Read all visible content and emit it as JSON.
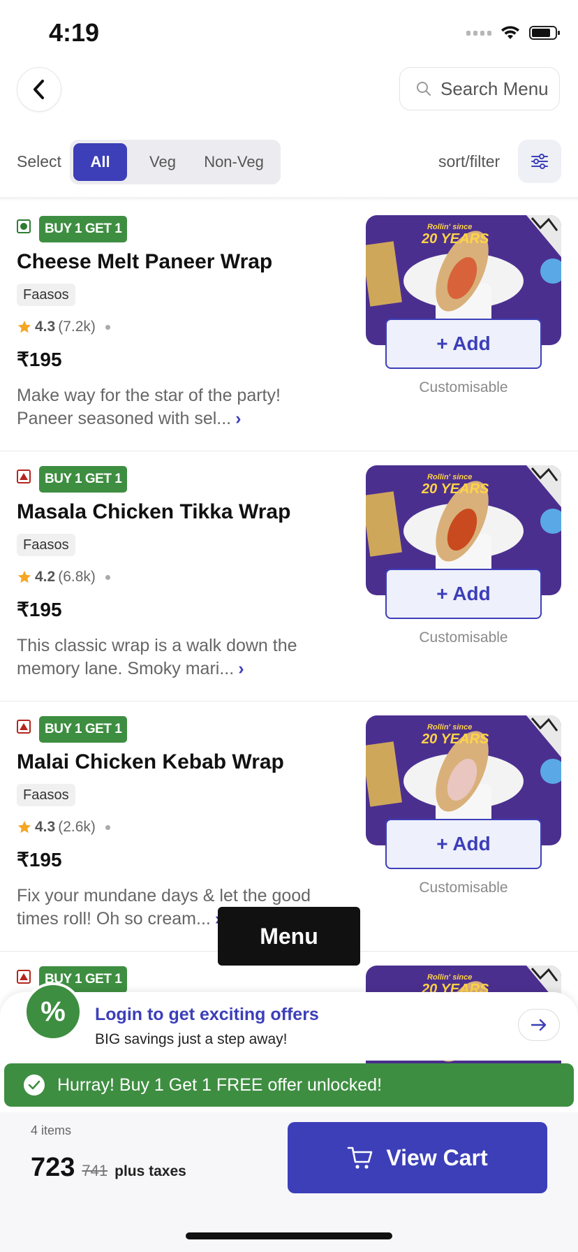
{
  "status_bar": {
    "time": "4:19"
  },
  "header": {
    "search_placeholder": "Search Menu"
  },
  "filters": {
    "select_label": "Select",
    "options": [
      "All",
      "Veg",
      "Non-Veg"
    ],
    "selected": "All",
    "sort_label": "sort/filter"
  },
  "items": [
    {
      "diet": "veg",
      "offer": "BUY 1 GET 1",
      "name": "Cheese Melt Paneer Wrap",
      "brand": "Faasos",
      "rating": "4.3",
      "rating_count": "(7.2k)",
      "price": "₹195",
      "description": "Make way for the star of the party! Paneer seasoned with sel...",
      "add_label": "+ Add",
      "customisable": "Customisable",
      "image_badge": "Rollin' since 20 YEARS"
    },
    {
      "diet": "non-veg",
      "offer": "BUY 1 GET 1",
      "name": "Masala Chicken Tikka Wrap",
      "brand": "Faasos",
      "rating": "4.2",
      "rating_count": "(6.8k)",
      "price": "₹195",
      "description": "This classic wrap is a walk down the memory lane. Smoky mari...",
      "add_label": "+ Add",
      "customisable": "Customisable",
      "image_badge": "Rollin' since 20 YEARS"
    },
    {
      "diet": "non-veg",
      "offer": "BUY 1 GET 1",
      "name": "Malai Chicken Kebab Wrap",
      "brand": "Faasos",
      "rating": "4.3",
      "rating_count": "(2.6k)",
      "price": "₹195",
      "description": "Fix your mundane days & let the good times roll! Oh so cream...",
      "add_label": "+ Add",
      "customisable": "Customisable",
      "image_badge": "Rollin' since 20 YEARS"
    },
    {
      "diet": "non-veg",
      "offer": "BUY 1 GET 1",
      "image_badge": "Rollin' since 20 YEARS"
    }
  ],
  "menu_button": "Menu",
  "login_banner": {
    "icon": "%",
    "title": "Login to get exciting offers",
    "subtitle": "BIG savings just a step away!"
  },
  "offer_strip": "Hurray! Buy 1 Get 1 FREE offer unlocked!",
  "cart": {
    "items_count": "4 items",
    "total": "723",
    "original_total": "741",
    "taxes_note": "plus taxes",
    "view_cart_label": "View Cart"
  },
  "colors": {
    "accent": "#3c3fb8",
    "offer_green": "#3e8e41",
    "veg_green": "#2e7d32",
    "nonveg_red": "#b3261e"
  }
}
